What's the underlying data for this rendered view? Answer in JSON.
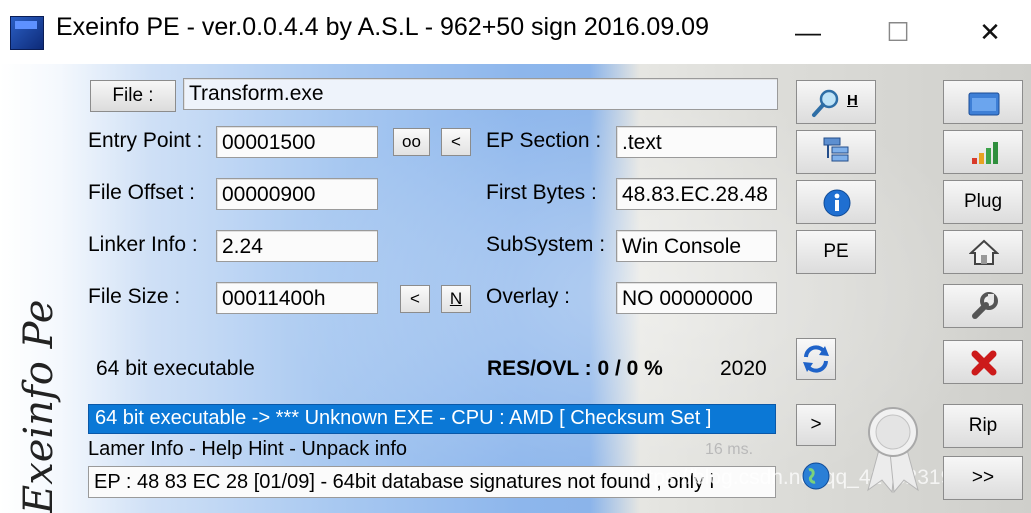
{
  "window": {
    "title": "Exeinfo PE - ver.0.0.4.4  by A.S.L -  962+50 sign  2016.09.09",
    "controls": {
      "minimize": "—",
      "maximize": "☐",
      "close": "✕"
    }
  },
  "side_logo_text": "Exeinfo Pe",
  "file": {
    "button_label": "File :",
    "value": "Transform.exe"
  },
  "entry_point": {
    "label": "Entry Point :",
    "value": "00001500",
    "btn_oo": "oo",
    "btn_lt": "<"
  },
  "ep_section": {
    "label": "EP Section :",
    "value": ".text"
  },
  "file_offset": {
    "label": "File Offset :",
    "value": "00000900"
  },
  "first_bytes": {
    "label": "First Bytes :",
    "value": "48.83.EC.28.48"
  },
  "linker_info": {
    "label": "Linker Info :",
    "value": "2.24"
  },
  "subsystem": {
    "label": "SubSystem :",
    "value": "Win Console"
  },
  "file_size": {
    "label": "File Size :",
    "value": "00011400h",
    "btn_lt": "<",
    "btn_n": "N"
  },
  "overlay": {
    "label": "Overlay :",
    "value": "NO  00000000"
  },
  "bit_info": "64 bit executable",
  "res_ovl": "RES/OVL : 0 / 0 %",
  "year": "2020",
  "status": "64 bit executable -> *** Unknown EXE  - CPU : AMD  [ Checksum Set ]",
  "lamer_info": "Lamer Info - Help Hint - Unpack info",
  "time_ms": "16 ms.",
  "ep_info": "EP : 48 83 EC 28 [01/09] - 64bit database signatures not found , only i",
  "watermark": "https://blog.csdn.net/qq_42382319",
  "toolbar_mid": {
    "h_label": "H",
    "pe_label": "PE",
    "next_label": ">"
  },
  "toolbar_right": {
    "plug_label": "Plug",
    "rip_label": "Rip",
    "more_label": ">>"
  },
  "colors": {
    "status_blue": "#0b78d6",
    "close_red": "#cc1a1a"
  }
}
